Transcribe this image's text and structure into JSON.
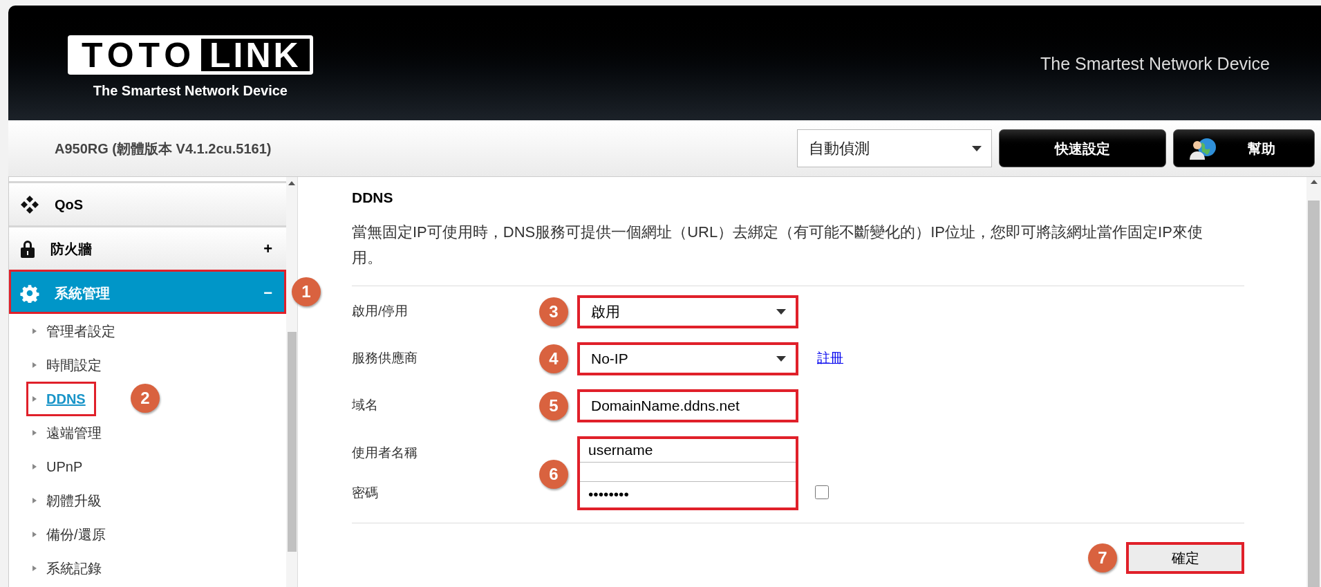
{
  "header": {
    "logo_left": "TOTO",
    "logo_right": "LINK",
    "logo_tagline": "The Smartest Network Device",
    "slogan": "The Smartest Network Device"
  },
  "topbar": {
    "model": "A950RG (韌體版本 V4.1.2cu.5161)",
    "language": "自動偵測",
    "buttons": [
      {
        "label": "快速設定",
        "kind": "plain"
      },
      {
        "label": "幫助",
        "kind": "help"
      }
    ]
  },
  "sidebar": {
    "groups": [
      {
        "label": "QoS",
        "kind": "qos",
        "selected": false,
        "highlighted": false
      },
      {
        "label": "防火牆",
        "kind": "lock",
        "toggle": "+",
        "selected": false,
        "highlighted": false
      },
      {
        "label": "系統管理",
        "kind": "gear",
        "toggle": "−",
        "selected": true,
        "highlighted": true,
        "step": "1",
        "children": [
          {
            "label": "管理者設定",
            "selected": false,
            "highlighted": false
          },
          {
            "label": "時間設定",
            "selected": false,
            "highlighted": false
          },
          {
            "label": "DDNS",
            "selected": true,
            "highlighted": true,
            "step": "2"
          },
          {
            "label": "遠端管理",
            "selected": false,
            "highlighted": false
          },
          {
            "label": "UPnP",
            "selected": false,
            "highlighted": false
          },
          {
            "label": "韌體升級",
            "selected": false,
            "highlighted": false
          },
          {
            "label": "備份/還原",
            "selected": false,
            "highlighted": false
          },
          {
            "label": "系統記錄",
            "selected": false,
            "highlighted": false
          }
        ]
      }
    ]
  },
  "form": {
    "title": "DDNS",
    "description": "當無固定IP可使用時，DNS服務可提供一個網址（URL）去綁定（有可能不斷變化的）IP位址，您即可將該網址當作固定IP來使用。",
    "fields": [
      {
        "kind": "select",
        "label": "啟用/停用",
        "value": "啟用",
        "step": "3",
        "highlighted": true
      },
      {
        "kind": "select",
        "label": "服務供應商",
        "value": "No-IP",
        "link": "註冊",
        "step": "4",
        "highlighted": true
      },
      {
        "kind": "text",
        "label": "域名",
        "value": "DomainName.ddns.net",
        "step": "5",
        "highlighted": true
      }
    ],
    "credentials": {
      "step": "6",
      "highlighted": true,
      "username_label": "使用者名稱",
      "username": "username",
      "password_label": "密碼",
      "password": "••••••••",
      "show_password": false
    },
    "submit": {
      "label": "確定",
      "step": "7",
      "highlighted": true
    }
  }
}
